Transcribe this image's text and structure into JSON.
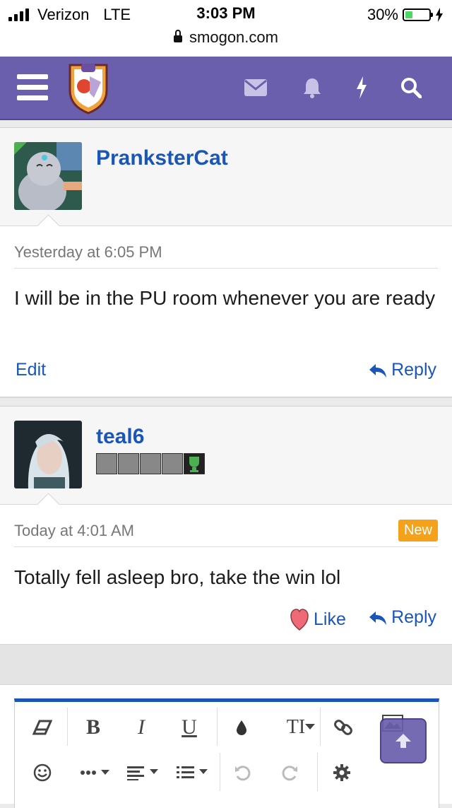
{
  "status_bar": {
    "carrier": "Verizon",
    "network": "LTE",
    "time": "3:03 PM",
    "domain": "smogon.com",
    "battery": "30%",
    "battery_level": 0.3
  },
  "navbar": {
    "icons": [
      "menu-icon",
      "smogon-logo",
      "mail-icon",
      "bell-icon",
      "lightning-icon",
      "search-icon"
    ],
    "background": "#6a5fad"
  },
  "posts": [
    {
      "username": "PranksterCat",
      "date": "Yesterday at 6:05 PM",
      "message": "I will be in the PU room whenever you are ready",
      "actions": {
        "left": "Edit",
        "right": "Reply"
      }
    },
    {
      "username": "teal6",
      "date": "Today at 4:01 AM",
      "badge": "New",
      "message": "Totally fell asleep bro, take the win lol",
      "actions": {
        "like": "Like",
        "right": "Reply"
      }
    }
  ],
  "editor": {
    "row1": [
      "eraser-icon",
      "B",
      "I",
      "U",
      "droplet-icon",
      "TI",
      "link-icon",
      "image-icon"
    ],
    "row2": [
      "smiley-icon",
      "more-icon",
      "align-icon",
      "list-icon",
      "undo-icon",
      "redo-icon",
      "gear-icon"
    ]
  },
  "colors": {
    "link": "#1a56b8",
    "new_badge": "#f4a11c",
    "accent": "#6a5fad"
  }
}
